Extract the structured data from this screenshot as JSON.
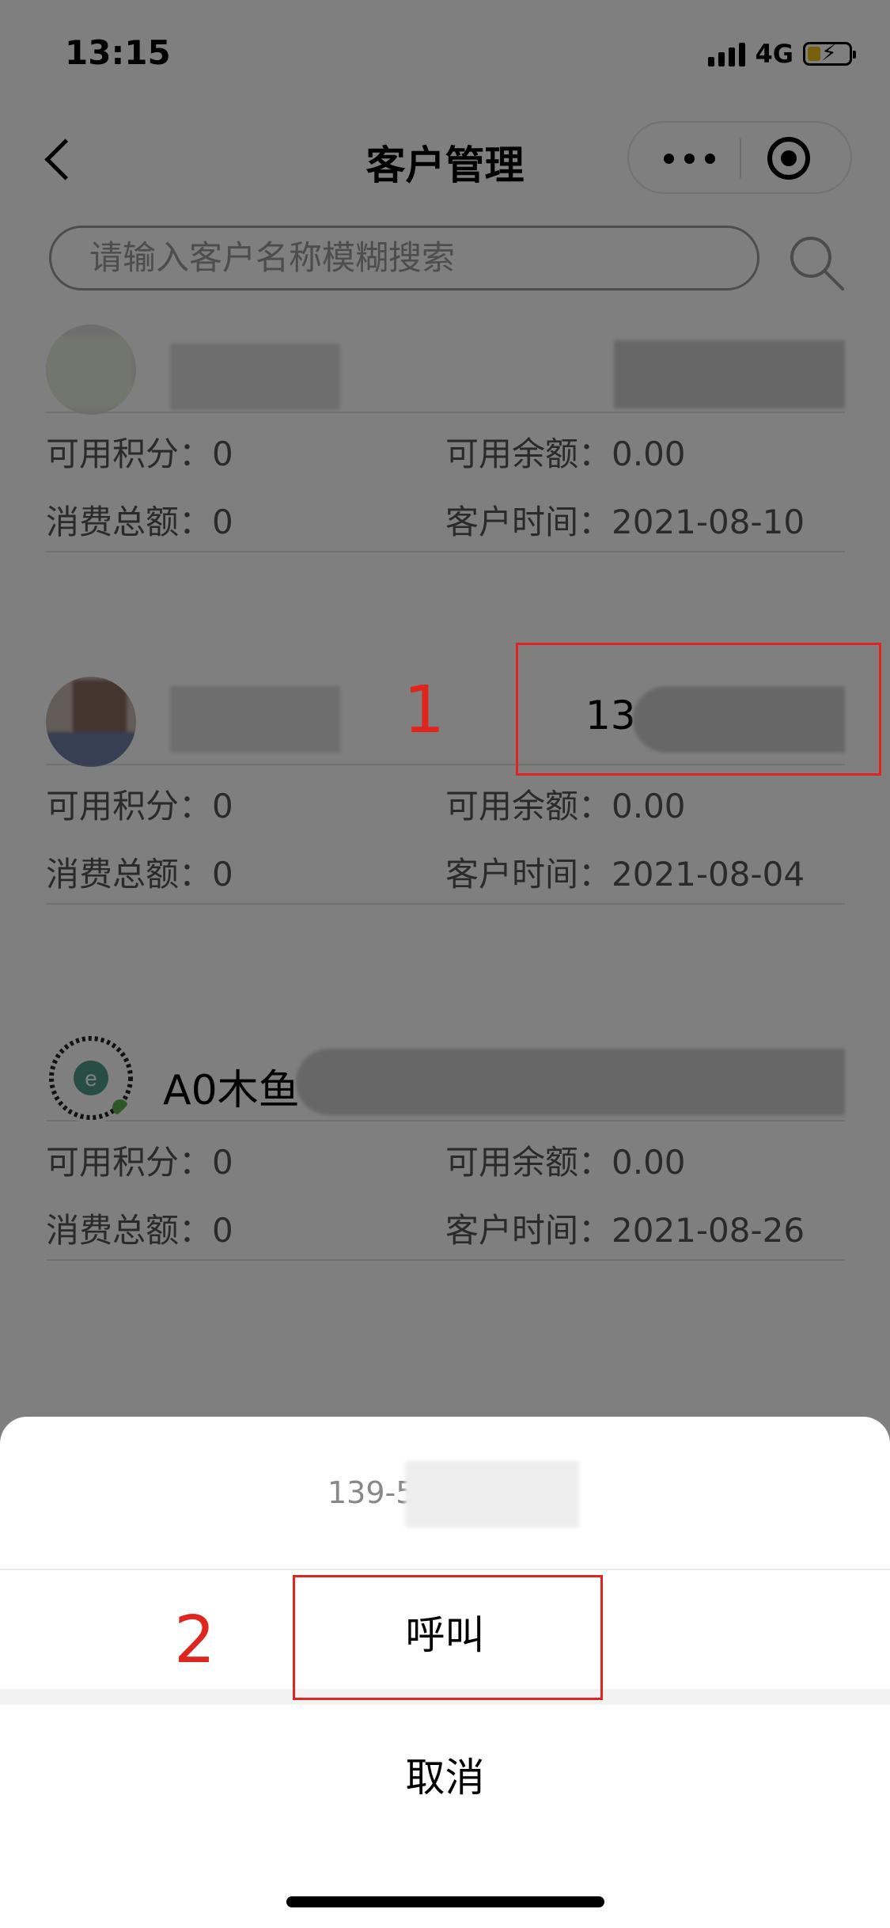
{
  "status_bar": {
    "time": "13:15",
    "network": "4G"
  },
  "nav": {
    "title": "客户管理"
  },
  "search": {
    "placeholder": "请输入客户名称模糊搜索"
  },
  "customers": [
    {
      "name": "",
      "phone": "",
      "points_label": "可用积分：",
      "points": "0",
      "balance_label": "可用余额：",
      "balance": "0.00",
      "spent_label": "消费总额：",
      "spent": "0",
      "date_label": "客户时间：",
      "date": "2021-08-10"
    },
    {
      "name": "",
      "phone": "13",
      "points_label": "可用积分：",
      "points": "0",
      "balance_label": "可用余额：",
      "balance": "0.00",
      "spent_label": "消费总额：",
      "spent": "0",
      "date_label": "客户时间：",
      "date": "2021-08-04"
    },
    {
      "name": "A0木鱼",
      "phone": "",
      "points_label": "可用积分：",
      "points": "0",
      "balance_label": "可用余额：",
      "balance": "0.00",
      "spent_label": "消费总额：",
      "spent": "0",
      "date_label": "客户时间：",
      "date": "2021-08-26"
    }
  ],
  "annotations": {
    "step1": "1",
    "step2": "2",
    "color": "#e0251f"
  },
  "action_sheet": {
    "phone": "139-5",
    "call_label": "呼叫",
    "cancel_label": "取消"
  }
}
